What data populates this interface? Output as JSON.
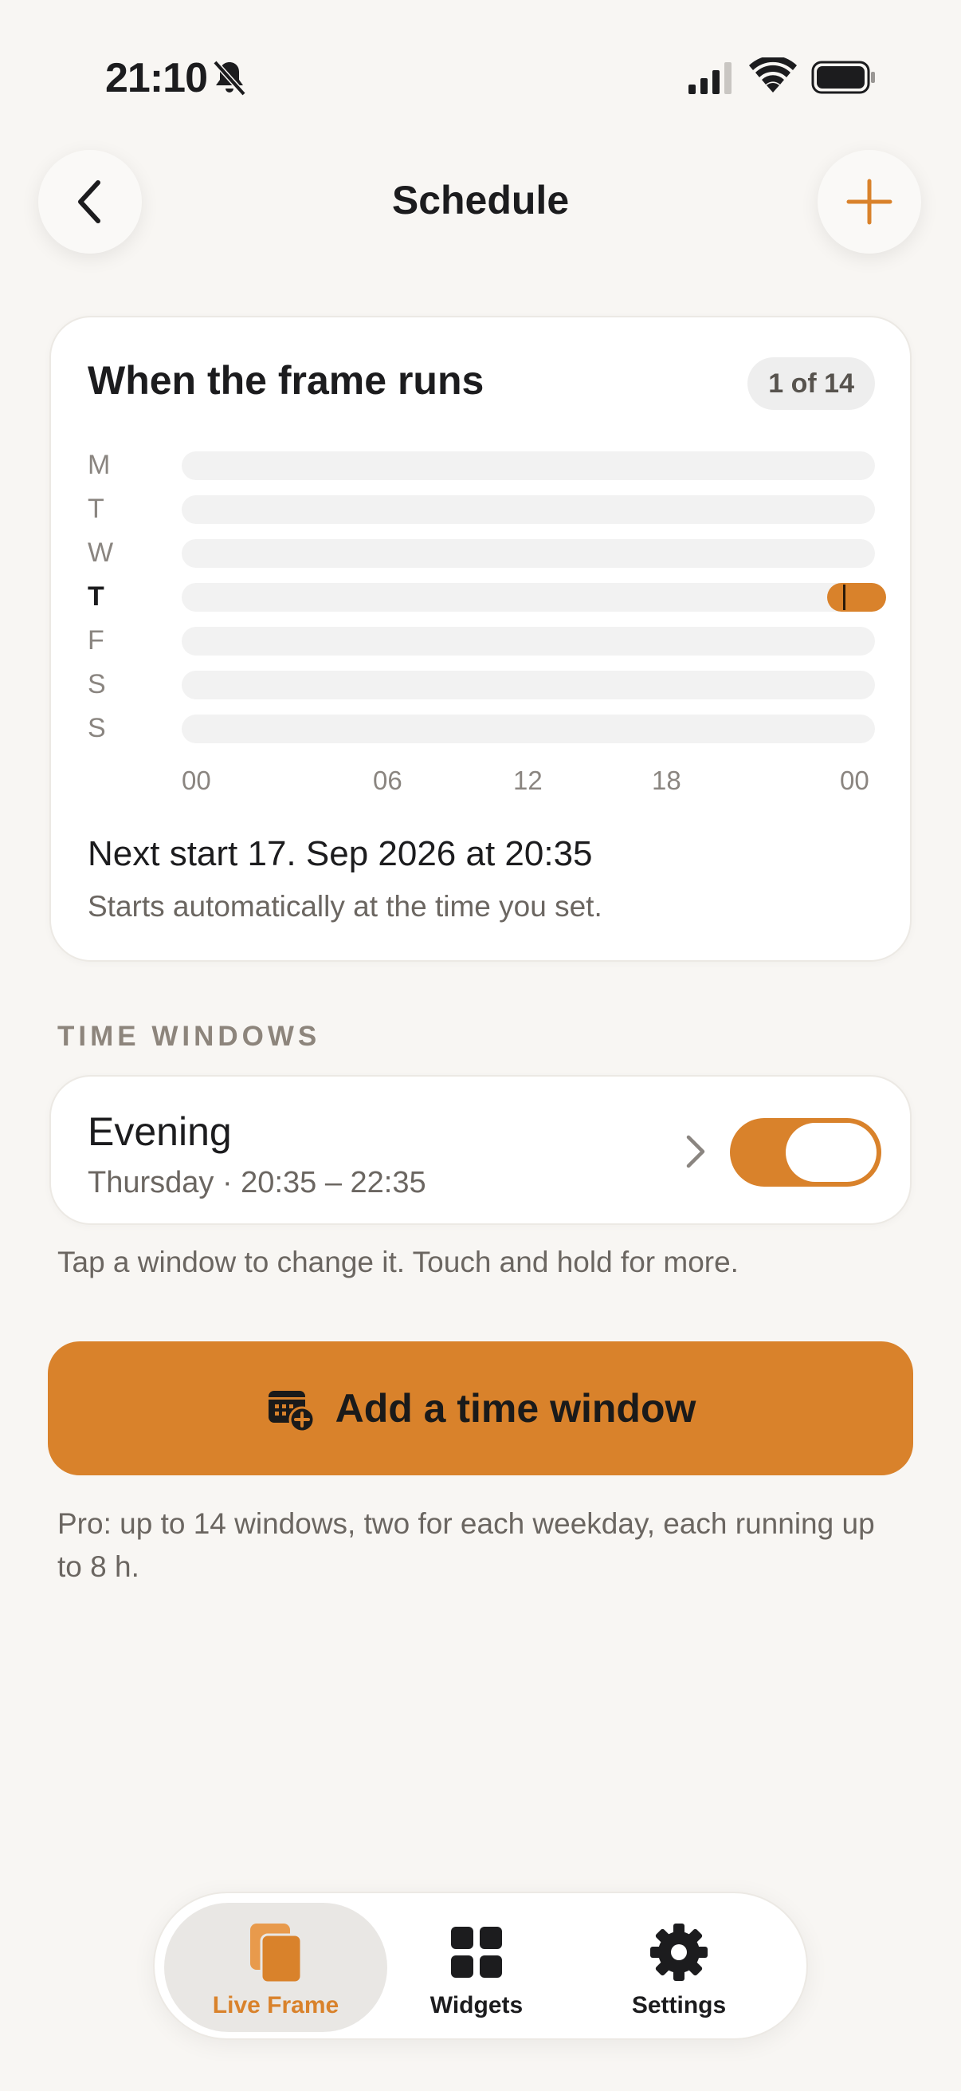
{
  "status_bar": {
    "time": "21:10"
  },
  "nav": {
    "title": "Schedule"
  },
  "schedule_card": {
    "title": "When the frame runs",
    "count": "1 of 14",
    "days": [
      {
        "label": "M",
        "today": false
      },
      {
        "label": "T",
        "today": false
      },
      {
        "label": "W",
        "today": false
      },
      {
        "label": "T",
        "today": true
      },
      {
        "label": "F",
        "today": false
      },
      {
        "label": "S",
        "today": false
      },
      {
        "label": "S",
        "today": false
      }
    ],
    "hour_labels": [
      "00",
      "06",
      "12",
      "18",
      "00"
    ],
    "next_start": "Next start 17. Sep 2026 at 20:35",
    "next_start_sub": "Starts automatically at the time you set."
  },
  "time_windows": {
    "section_label": "TIME WINDOWS",
    "items": [
      {
        "name": "Evening",
        "detail": "Thursday · 20:35 – 22:35",
        "enabled": true
      }
    ],
    "hint": "Tap a window to change it. Touch and hold for more."
  },
  "add_button": {
    "label": "Add a time window"
  },
  "pro_note": "Pro: up to 14 windows, two for each weekday, each running up to 8 h.",
  "tabbar": {
    "tabs": [
      {
        "label": "Live Frame",
        "icon": "live-frame-icon",
        "active": true
      },
      {
        "label": "Widgets",
        "icon": "widgets-grid-icon",
        "active": false
      },
      {
        "label": "Settings",
        "icon": "gear-icon",
        "active": false
      }
    ]
  },
  "colors": {
    "accent": "#d9822b",
    "background": "#f8f6f3",
    "card": "#ffffff"
  }
}
